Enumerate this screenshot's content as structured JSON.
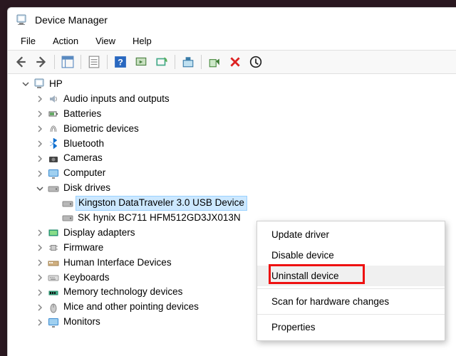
{
  "window": {
    "title": "Device Manager"
  },
  "menubar": [
    "File",
    "Action",
    "View",
    "Help"
  ],
  "root": "HP",
  "categories": {
    "audio": "Audio inputs and outputs",
    "batt": "Batteries",
    "bio": "Biometric devices",
    "bt": "Bluetooth",
    "cam": "Cameras",
    "comp": "Computer",
    "disk": "Disk drives",
    "disk_children": {
      "kingston": "Kingston DataTraveler 3.0 USB Device",
      "skhynix": "SK hynix BC711 HFM512GD3JX013N"
    },
    "disp": "Display adapters",
    "fw": "Firmware",
    "hid": "Human Interface Devices",
    "kb": "Keyboards",
    "mem": "Memory technology devices",
    "mice": "Mice and other pointing devices",
    "mon": "Monitors"
  },
  "ctx": {
    "update": "Update driver",
    "disable": "Disable device",
    "uninstall": "Uninstall device",
    "scan": "Scan for hardware changes",
    "props": "Properties"
  }
}
